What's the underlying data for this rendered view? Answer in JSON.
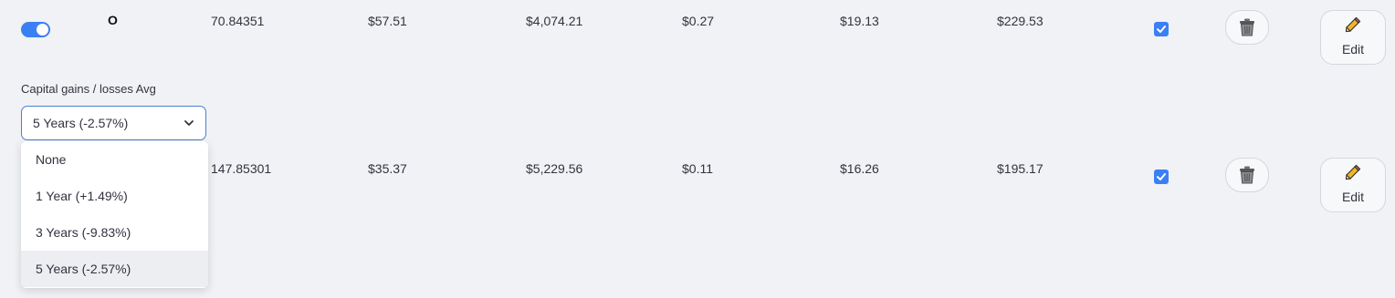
{
  "rows": [
    {
      "ticker": "O",
      "shares": "70.84351",
      "price": "$57.51",
      "value": "$4,074.21",
      "dividend": "$0.27",
      "annual": "$19.13",
      "total": "$229.53",
      "toggle_on": true,
      "checked": true,
      "edit_label": "Edit"
    },
    {
      "ticker": "",
      "shares": "147.85301",
      "price": "$35.37",
      "value": "$5,229.56",
      "dividend": "$0.11",
      "annual": "$16.26",
      "total": "$195.17",
      "checked": true,
      "edit_label": "Edit"
    }
  ],
  "capital_gains": {
    "label": "Capital gains / losses Avg",
    "selected": "5 Years (-2.57%)",
    "options": [
      "None",
      "1 Year (+1.49%)",
      "3 Years (-9.83%)",
      "5 Years (-2.57%)"
    ],
    "highlighted_option": "5 Years (-2.57%)"
  },
  "colors": {
    "accent": "#3b7ff5",
    "background": "#f1f2f5",
    "select_border": "#4a7fd6"
  },
  "icons": {
    "delete": "trash-icon",
    "edit": "pencil-icon",
    "select": "chevron-down-icon",
    "checkbox": "check-icon"
  }
}
